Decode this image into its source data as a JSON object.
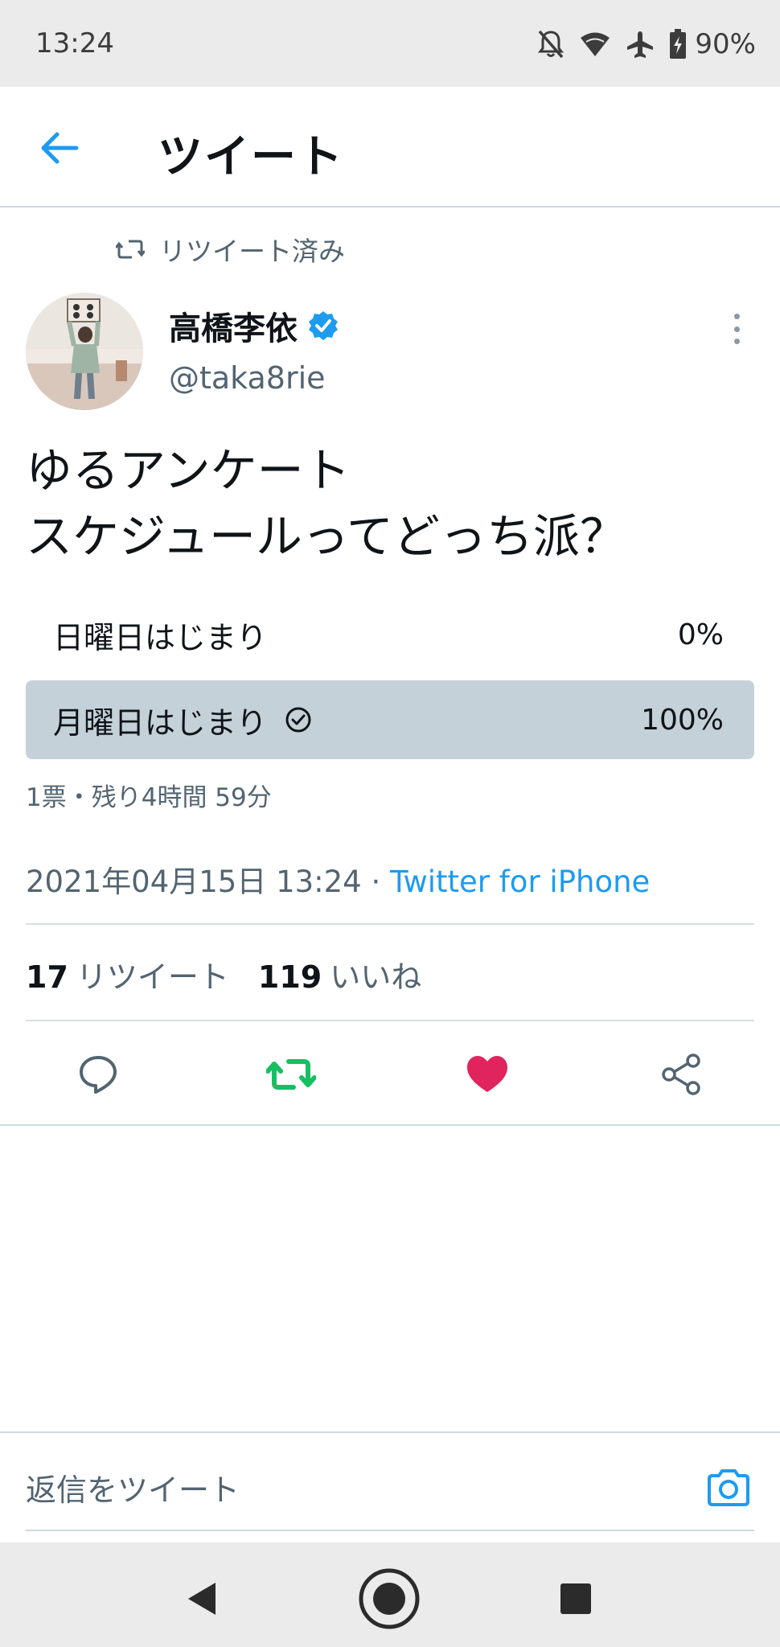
{
  "status_bar": {
    "time": "13:24",
    "battery": "90%",
    "icons": [
      "notifications-off-icon",
      "wifi-icon",
      "airplane-icon",
      "battery-charging-icon"
    ]
  },
  "header": {
    "title": "ツイート",
    "back_icon": "arrow-left-icon"
  },
  "retweet_indicator": {
    "label": "リツイート済み",
    "icon": "retweet-icon"
  },
  "author": {
    "name": "高橋李依",
    "handle": "@taka8rie",
    "verified": true
  },
  "tweet": {
    "lines": [
      "ゆるアンケート",
      "スケジュールってどっち派？"
    ]
  },
  "poll": {
    "options": [
      {
        "label": "日曜日はじまり",
        "percent_text": "0%",
        "fraction": 0,
        "selected": false
      },
      {
        "label": "月曜日はじまり",
        "percent_text": "100%",
        "fraction": 1,
        "selected": true
      }
    ],
    "meta": "1票・残り4時間 59分"
  },
  "timestamp": {
    "datetime": "2021年04月15日 13:24",
    "separator": " · ",
    "source": "Twitter for iPhone"
  },
  "stats": {
    "retweets_count": "17",
    "retweets_label": "リツイート",
    "likes_count": "119",
    "likes_label": "いいね"
  },
  "actions": [
    {
      "name": "reply",
      "icon": "reply-icon"
    },
    {
      "name": "retweet",
      "icon": "retweet-icon",
      "active": true,
      "color": "#17bf63"
    },
    {
      "name": "like",
      "icon": "heart-icon",
      "active": true,
      "color": "#e0245e"
    },
    {
      "name": "share",
      "icon": "share-icon"
    }
  ],
  "reply_box": {
    "placeholder": "返信をツイート",
    "camera_icon": "camera-icon"
  },
  "colors": {
    "accent": "#1d9bf0",
    "poll_fill": "#c5d1d9",
    "secondary_text": "#536471",
    "retweet_green": "#17bf63",
    "like_red": "#e0245e"
  },
  "nav_bar": {
    "buttons": [
      "back-triangle-icon",
      "home-circle-icon",
      "recents-square-icon"
    ]
  }
}
